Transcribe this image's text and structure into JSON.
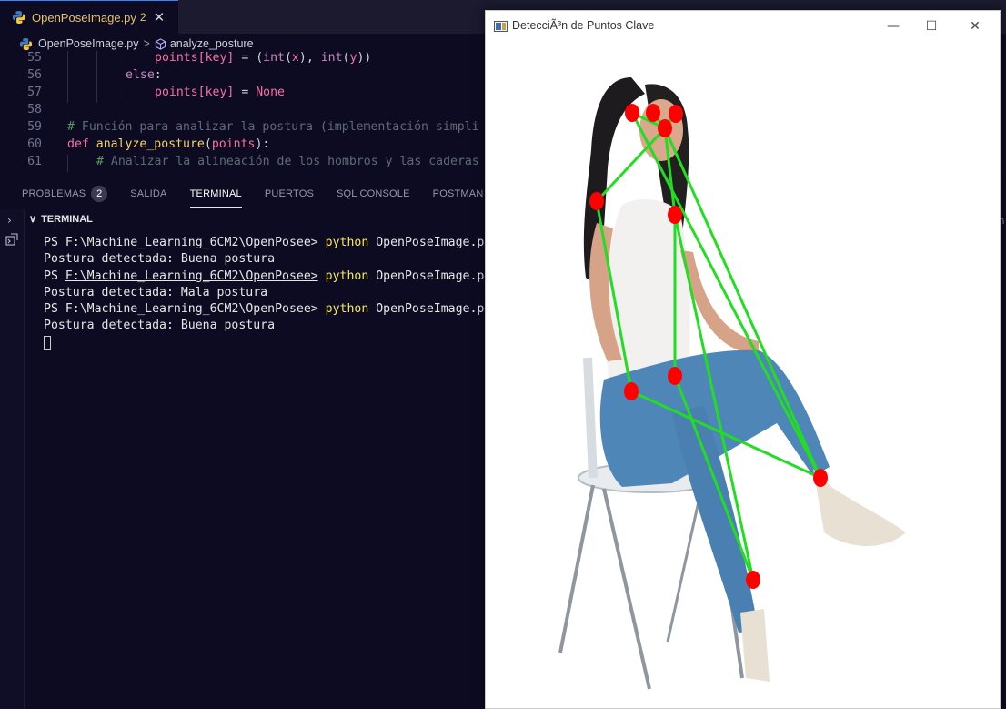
{
  "editor": {
    "tab": {
      "filename": "OpenPoseImage.py",
      "problem_count": "2",
      "close_glyph": "✕"
    },
    "breadcrumb": {
      "file": "OpenPoseImage.py",
      "separator": ">",
      "symbol": "analyze_posture"
    },
    "lines": [
      {
        "num": "55",
        "indent": 3,
        "tokens": [
          [
            "var",
            "points"
          ],
          [
            "op",
            "["
          ],
          [
            "var",
            "key"
          ],
          [
            "op",
            "]"
          ],
          [
            "txt",
            " = ("
          ],
          [
            "bi",
            "int"
          ],
          [
            "txt",
            "("
          ],
          [
            "var",
            "x"
          ],
          [
            "txt",
            "), "
          ],
          [
            "bi",
            "int"
          ],
          [
            "txt",
            "("
          ],
          [
            "var",
            "y"
          ],
          [
            "txt",
            "))"
          ]
        ]
      },
      {
        "num": "56",
        "indent": 2,
        "tokens": [
          [
            "kw",
            "else"
          ],
          [
            "txt",
            ":"
          ]
        ]
      },
      {
        "num": "57",
        "indent": 3,
        "tokens": [
          [
            "var",
            "points"
          ],
          [
            "op",
            "["
          ],
          [
            "var",
            "key"
          ],
          [
            "op",
            "]"
          ],
          [
            "txt",
            " = "
          ],
          [
            "kwd",
            "None"
          ]
        ]
      },
      {
        "num": "58",
        "indent": 0,
        "tokens": []
      },
      {
        "num": "59",
        "indent": 0,
        "tokens": [
          [
            "cmH",
            "# "
          ],
          [
            "cm",
            "Función para analizar la postura (implementación simpli"
          ]
        ]
      },
      {
        "num": "60",
        "indent": 0,
        "tokens": [
          [
            "kwd",
            "def "
          ],
          [
            "fn",
            "analyze_posture"
          ],
          [
            "txt",
            "("
          ],
          [
            "var",
            "points"
          ],
          [
            "txt",
            "):"
          ]
        ]
      },
      {
        "num": "61",
        "indent": 1,
        "tokens": [
          [
            "cmH",
            "# "
          ],
          [
            "cm",
            "Analizar la alineación de los hombros y las caderas"
          ]
        ]
      }
    ]
  },
  "panel": {
    "tabs": [
      {
        "label": "PROBLEMAS",
        "badge": "2",
        "active": false
      },
      {
        "label": "SALIDA",
        "active": false
      },
      {
        "label": "TERMINAL",
        "active": true
      },
      {
        "label": "PUERTOS",
        "active": false
      },
      {
        "label": "SQL CONSOLE",
        "active": false
      },
      {
        "label": "POSTMAN CON",
        "active": false
      }
    ],
    "terminal_title": "TERMINAL",
    "terminal_lines": [
      {
        "prompt": "PS F:\\Machine_Learning_6CM2\\OpenPosee>",
        "underline": false,
        "cmd": "python",
        "args": "OpenPoseImage.py"
      },
      {
        "output": "Postura detectada: Buena postura"
      },
      {
        "prompt": "PS F:\\Machine_Learning_6CM2\\OpenPosee>",
        "underline": true,
        "cmd": "python",
        "args": "OpenPoseImage.py"
      },
      {
        "output": "Postura detectada: Mala postura"
      },
      {
        "prompt": "PS F:\\Machine_Learning_6CM2\\OpenPosee>",
        "underline": false,
        "cmd": "python",
        "args": "OpenPoseImage.py"
      },
      {
        "output": "Postura detectada: Buena postura"
      }
    ]
  },
  "cv_window": {
    "title": "DetecciÃ³n de Puntos Clave",
    "minimize": "—",
    "maximize": "☐",
    "close": "✕",
    "keypoint_color": "#ff0000",
    "skeleton_color": "#22dd22"
  },
  "colors": {
    "editor_bg": "#0d0b22",
    "accent": "#3b82f6",
    "command": "#f6e95d"
  }
}
